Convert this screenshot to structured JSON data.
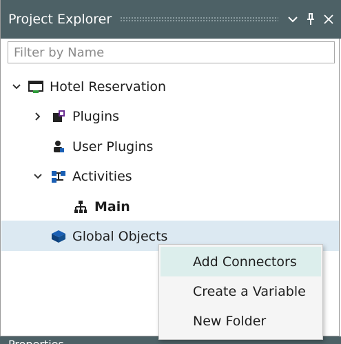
{
  "panel": {
    "title": "Project Explorer",
    "buttons": {
      "menu_icon": "chevron-down-icon",
      "pin_icon": "pin-icon",
      "close_icon": "close-icon"
    }
  },
  "filter": {
    "placeholder": "Filter by Name",
    "value": ""
  },
  "tree": {
    "root": {
      "label": "Hotel Reservation",
      "icon": "project-icon",
      "expanded": true
    },
    "plugins": {
      "label": "Plugins",
      "icon": "plugin-icon",
      "expanded": false
    },
    "user_plugins": {
      "label": "User Plugins",
      "icon": "user-plugin-icon"
    },
    "activities": {
      "label": "Activities",
      "icon": "activities-icon",
      "expanded": true
    },
    "main": {
      "label": "Main",
      "icon": "flow-icon"
    },
    "global_objects": {
      "label": "Global Objects",
      "icon": "cube-icon",
      "selected": true
    }
  },
  "context_menu": {
    "items": [
      "Add Connectors",
      "Create a Variable",
      "New Folder"
    ],
    "highlighted": 0
  },
  "bottom_panel": {
    "title": "Properties"
  },
  "colors": {
    "titlebar": "#4d6166",
    "selection": "#dce9f2",
    "menu_hover": "#dceeec",
    "plugin_purple": "#6a2d91",
    "activity_blue": "#1a5fb4"
  }
}
